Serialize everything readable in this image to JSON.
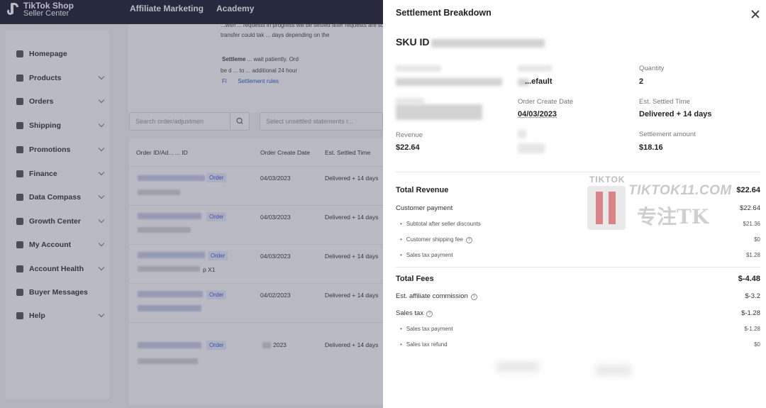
{
  "header": {
    "logo_line1": "TikTok Shop",
    "logo_line2": "Seller Center",
    "nav": [
      "Affiliate Marketing",
      "Academy"
    ]
  },
  "sidebar": {
    "items": [
      {
        "label": "Homepage",
        "icon": "home-icon",
        "chevron": false
      },
      {
        "label": "Products",
        "icon": "box-icon",
        "chevron": true
      },
      {
        "label": "Orders",
        "icon": "orders-icon",
        "chevron": true
      },
      {
        "label": "Shipping",
        "icon": "truck-icon",
        "chevron": true
      },
      {
        "label": "Promotions",
        "icon": "megaphone-icon",
        "chevron": true
      },
      {
        "label": "Finance",
        "icon": "wallet-icon",
        "chevron": true
      },
      {
        "label": "Data Compass",
        "icon": "chart-icon",
        "chevron": true
      },
      {
        "label": "Growth Center",
        "icon": "medal-icon",
        "chevron": true
      },
      {
        "label": "My Account",
        "icon": "user-icon",
        "chevron": true
      },
      {
        "label": "Account Health",
        "icon": "shield-icon",
        "chevron": true
      },
      {
        "label": "Buyer Messages",
        "icon": "message-icon",
        "chevron": false
      },
      {
        "label": "Help",
        "icon": "help-icon",
        "chevron": true
      }
    ]
  },
  "notice": {
    "line1": "...with ... requests in progress will be settled after requests are solved. Settleme",
    "line2": "transfer could tak ... days depending on the",
    "line3_bold": "Settleme",
    "line3": " ... wait patiently. Ord",
    "line4": "be d ... to ... additional 24 hour",
    "link": "Settlement rules",
    "link_prefix": "Fi"
  },
  "filters": {
    "search_placeholder": "Search order/adjustmen",
    "select_placeholder": "Select unsettled statements r..."
  },
  "table": {
    "headers": [
      "Order ID/Ad... ... ID",
      "Order Create Date",
      "Est. Settled Time"
    ],
    "tag": "Order",
    "rows": [
      {
        "date": "04/03/2023",
        "settled": "Delivered + 14 days",
        "extra": ""
      },
      {
        "date": "04/03/2023",
        "settled": "Delivered + 14 days",
        "extra": ""
      },
      {
        "date": "04/03/2023",
        "settled": "Delivered + 14 days",
        "extra": "p X1"
      },
      {
        "date": "04/02/2023",
        "settled": "Delivered + 14 days",
        "extra": ""
      },
      {
        "date": "2023",
        "settled": "Delivered + 14 days",
        "extra": ""
      }
    ]
  },
  "drawer": {
    "title": "Settlement Breakdown",
    "sku_label": "SKU ID",
    "variation_value": "...efault",
    "quantity_label": "Quantity",
    "quantity_value": "2",
    "order_create_label": "Order Create Date",
    "order_create_value": "04/03/2023",
    "est_settled_label": "Est. Settled Time",
    "est_settled_value": "Delivered + 14 days",
    "revenue_label": "Revenue",
    "revenue_value": "$22.64",
    "settlement_label": "Settlement amount",
    "settlement_value": "$18.16",
    "total_revenue_label": "Total Revenue",
    "total_revenue_value": "$22.64",
    "customer_payment_label": "Customer payment",
    "customer_payment_value": "$22.64",
    "subtotal_label": "Subtotal after seller discounts",
    "subtotal_value": "$21.36",
    "shipping_label": "Customer shipping fee",
    "shipping_value": "$0",
    "sales_tax_payment_label": "Sales tax payment",
    "sales_tax_payment_value": "$1.28",
    "total_fees_label": "Total Fees",
    "total_fees_value": "$-4.48",
    "affiliate_label": "Est. affiliate commission",
    "affiliate_value": "$-3.2",
    "sales_tax_label": "Sales tax",
    "sales_tax_value": "$-1.28",
    "fee_sales_tax_payment_label": "Sales tax payment",
    "fee_sales_tax_payment_value": "$-1.28",
    "sales_tax_refund_label": "Sales tax refund",
    "sales_tax_refund_value": "$0"
  },
  "watermark": {
    "small": "TIKTOK",
    "site": "TIKTOK11.COM",
    "chinese": "专注TK"
  }
}
